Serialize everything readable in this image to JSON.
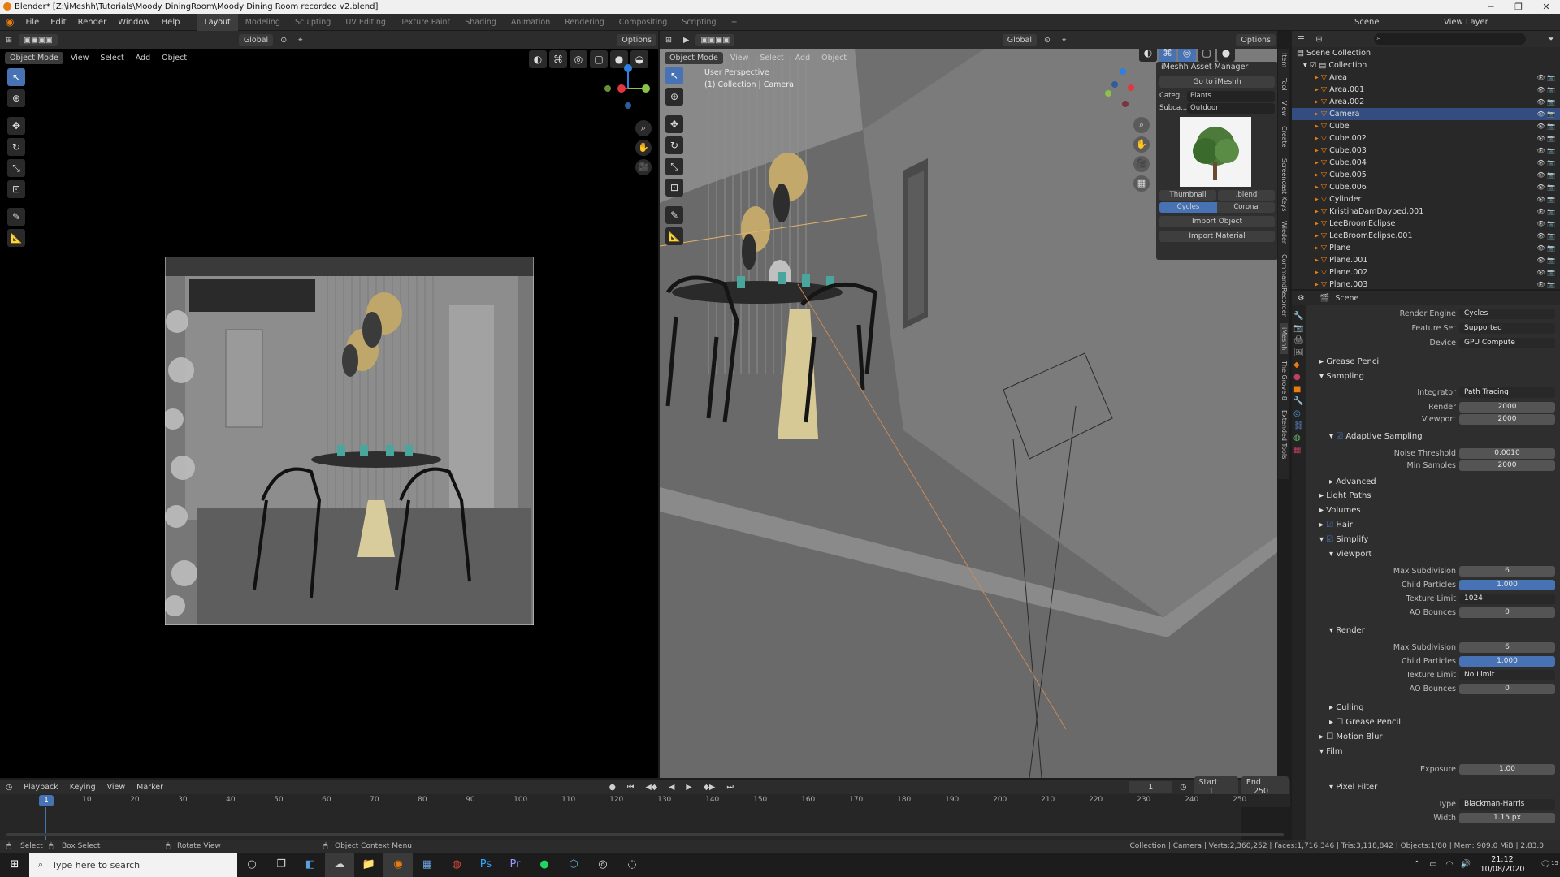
{
  "window": {
    "title": "Blender* [Z:\\iMeshh\\Tutorials\\Moody DiningRoom\\Moody Dining Room recorded v2.blend]",
    "controls": [
      "─",
      "❐",
      "✕"
    ]
  },
  "menu": {
    "items": [
      "File",
      "Edit",
      "Render",
      "Window",
      "Help"
    ],
    "workspaces": [
      "Layout",
      "Modeling",
      "Sculpting",
      "UV Editing",
      "Texture Paint",
      "Shading",
      "Animation",
      "Rendering",
      "Compositing",
      "Scripting",
      "+"
    ],
    "scene": "Scene",
    "view_layer": "View Layer"
  },
  "toolheader": {
    "orientation": "Global",
    "options": "Options"
  },
  "left_view": {
    "mode": "Object Mode",
    "menus": [
      "View",
      "Select",
      "Add",
      "Object"
    ]
  },
  "right_view": {
    "mode": "Object Mode",
    "menus": [
      "View",
      "Select",
      "Add",
      "Object"
    ],
    "overlay_title": "User Perspective",
    "overlay_sub": "(1) Collection | Camera"
  },
  "imeshh": {
    "title": "iMeshh Asset Manager",
    "goto": "Go to iMeshh",
    "category_label": "Categ...",
    "category": "Plants",
    "subcat_label": "Subca...",
    "subcat": "Outdoor",
    "thumb_btn": "Thumbnail",
    "blend_btn": ".blend",
    "engine_a": "Cycles",
    "engine_b": "Corona",
    "import_obj": "Import Object",
    "import_mat": "Import Material"
  },
  "sidetabs": [
    "Item",
    "Tool",
    "View",
    "Create",
    "Screencast Keys",
    "Wieder",
    "CommandRecorder",
    "iMeshh",
    "The Grove 8",
    "Extended Tools"
  ],
  "outliner": {
    "root": "Scene Collection",
    "collection": "Collection",
    "items": [
      "Area",
      "Area.001",
      "Area.002",
      "Camera",
      "Cube",
      "Cube.002",
      "Cube.003",
      "Cube.004",
      "Cube.005",
      "Cube.006",
      "Cylinder",
      "KristinaDamDaybed.001",
      "LeeBroomEclipse",
      "LeeBroomEclipse.001",
      "Plane",
      "Plane.001",
      "Plane.002",
      "Plane.003"
    ],
    "selected": "Camera"
  },
  "properties": {
    "context": "Scene",
    "render_engine_label": "Render Engine",
    "render_engine": "Cycles",
    "feature_set_label": "Feature Set",
    "feature_set": "Supported",
    "device_label": "Device",
    "device": "GPU Compute",
    "grease_pencil": "Grease Pencil",
    "sampling": "Sampling",
    "integrator_label": "Integrator",
    "integrator": "Path Tracing",
    "render_label": "Render",
    "render_samples": "2000",
    "viewport_label": "Viewport",
    "viewport_samples": "2000",
    "adaptive": "Adaptive Sampling",
    "noise_label": "Noise Threshold",
    "noise": "0.0010",
    "minsamp_label": "Min Samples",
    "minsamp": "2000",
    "advanced": "Advanced",
    "light_paths": "Light Paths",
    "volumes": "Volumes",
    "hair": "Hair",
    "simplify": "Simplify",
    "viewport_sub": "Viewport",
    "maxsub_label": "Max Subdivision",
    "v_maxsub": "6",
    "childp_label": "Child Particles",
    "v_childp": "1.000",
    "texlim_label": "Texture Limit",
    "v_texlim": "1024",
    "ao_label": "AO Bounces",
    "v_ao": "0",
    "render_sub": "Render",
    "r_maxsub": "6",
    "r_childp": "1.000",
    "r_texlim": "No Limit",
    "r_ao": "0",
    "culling": "Culling",
    "grease_pencil2": "Grease Pencil",
    "motion_blur": "Motion Blur",
    "film": "Film",
    "exposure_label": "Exposure",
    "exposure": "1.00",
    "pixel_filter": "Pixel Filter",
    "type_label": "Type",
    "type": "Blackman-Harris",
    "width_label": "Width",
    "width": "1.15 px"
  },
  "timeline": {
    "menus": [
      "Playback",
      "Keying",
      "View",
      "Marker"
    ],
    "current": "1",
    "start_label": "Start",
    "start": "1",
    "end_label": "End",
    "end": "250",
    "ticks": [
      "10",
      "20",
      "30",
      "40",
      "50",
      "60",
      "70",
      "80",
      "90",
      "100",
      "110",
      "120",
      "130",
      "140",
      "150",
      "160",
      "170",
      "180",
      "190",
      "200",
      "210",
      "220",
      "230",
      "240",
      "250"
    ],
    "frame_marker": "1"
  },
  "statusbar": {
    "select": "Select",
    "box": "Box Select",
    "rotate": "Rotate View",
    "ctx": "Object Context Menu",
    "stats": "Collection | Camera | Verts:2,360,252 | Faces:1,716,346 | Tris:3,118,842 | Objects:1/80 | Mem: 909.0 MiB | 2.83.0"
  },
  "taskbar": {
    "search": "Type here to search",
    "time": "21:12",
    "date": "10/08/2020",
    "notif": "15"
  },
  "colors": {
    "accent": "#4772b3",
    "orange": "#e87d0d",
    "selected_row": "#334d80"
  }
}
